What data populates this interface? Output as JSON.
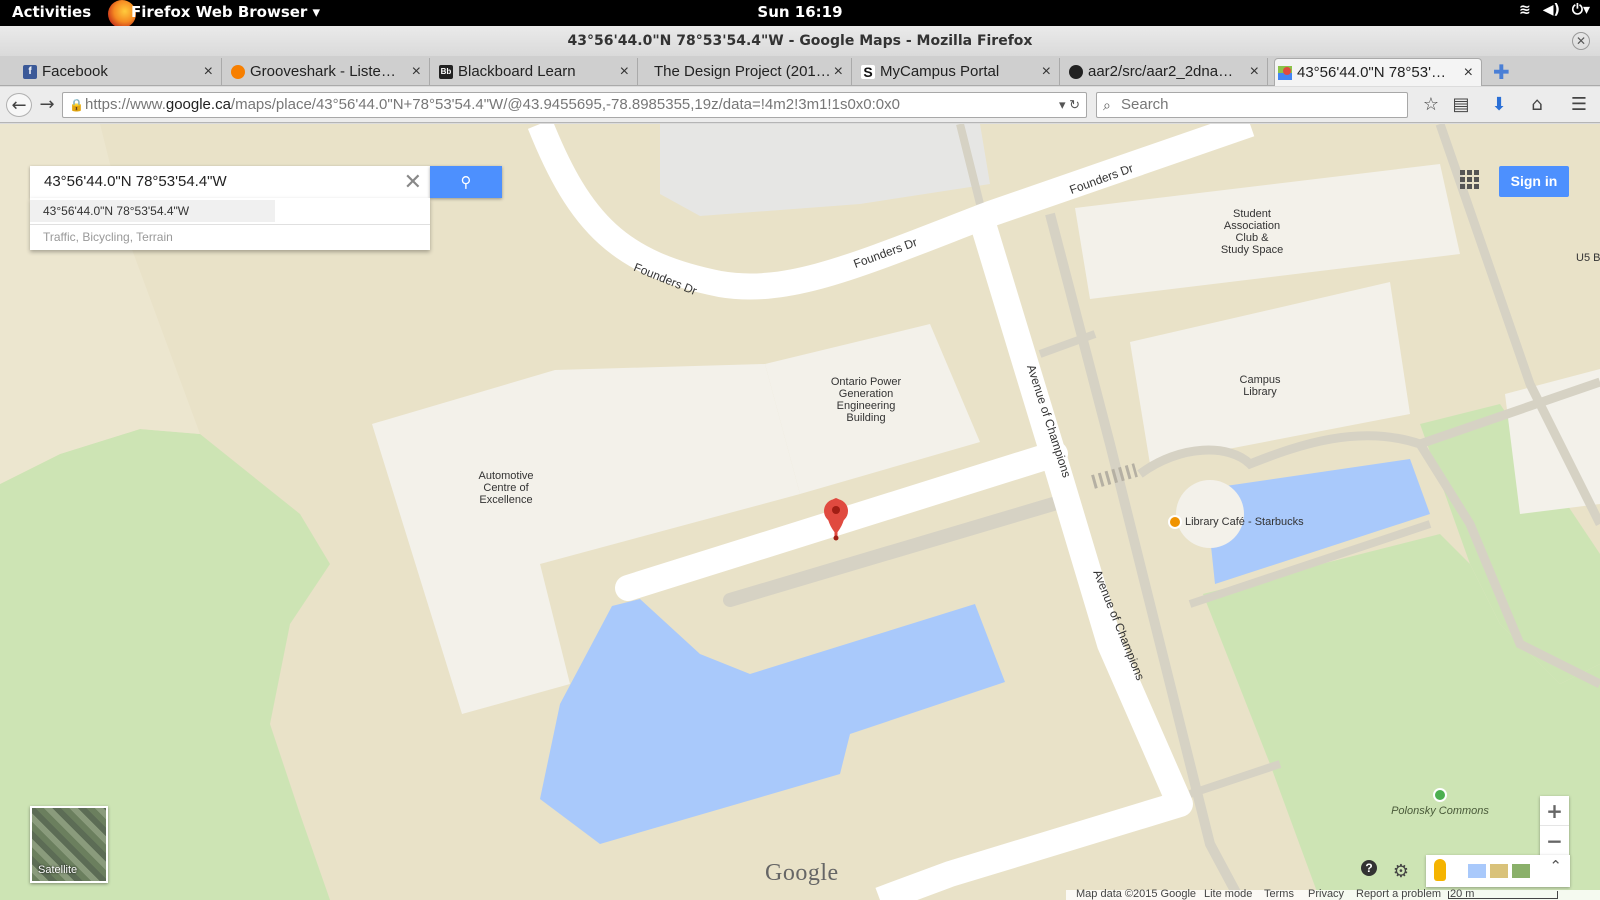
{
  "topbar": {
    "activities": "Activities",
    "app_menu": "Firefox Web Browser ▾",
    "clock": "Sun 16:19"
  },
  "window": {
    "title": "43°56'44.0\"N 78°53'54.4\"W - Google Maps - Mozilla Firefox"
  },
  "tabs": [
    {
      "label": "Facebook",
      "icon": "facebook-icon",
      "color": "#3b5998"
    },
    {
      "label": "Grooveshark - Liste…",
      "icon": "grooveshark-icon",
      "color": "#f77f00"
    },
    {
      "label": "Blackboard Learn",
      "icon": "blackboard-icon",
      "color": "#222222"
    },
    {
      "label": "The Design Project (201…",
      "icon": "",
      "color": ""
    },
    {
      "label": "MyCampus Portal",
      "icon": "s-icon",
      "color": "#111111"
    },
    {
      "label": "aar2/src/aar2_2dna…",
      "icon": "github-icon",
      "color": "#222222"
    },
    {
      "label": "43°56'44.0\"N 78°53'…",
      "icon": "google-maps-icon",
      "color": "#e04a3f"
    }
  ],
  "navbar": {
    "url_prefix": "https://www.",
    "url_host": "google.ca",
    "url_rest": "/maps/place/43°56'44.0\"N+78°53'54.4\"W/@43.9455695,-78.8985355,19z/data=!4m2!3m1!1s0x0:0x0",
    "search_placeholder": "Search"
  },
  "map": {
    "search_value": "43°56'44.0\"N 78°53'54.4\"W",
    "suggestion_1": "43°56'44.0\"N 78°53'54.4\"W",
    "suggestion_2": "Traffic, Bicycling, Terrain",
    "sign_in": "Sign in",
    "satellite": "Satellite",
    "google": "Google",
    "labels": {
      "student_association": "Student\nAssociation\nClub &\nStudy Space",
      "us": "U5 B",
      "campus_library": "Campus\nLibrary",
      "opg": "Ontario Power\nGeneration\nEngineering\nBuilding",
      "automotive": "Automotive\nCentre of\nExcellence",
      "library_cafe": "Library Café - Starbucks",
      "polonsky": "Polonsky Commons"
    },
    "roads": {
      "founders_1": "Founders Dr",
      "founders_2": "Founders Dr",
      "founders_3": "Founders Dr",
      "avenue_1": "Avenue of Champions",
      "avenue_2": "Avenue of Champions"
    },
    "footer": {
      "map_data": "Map data ©2015 Google",
      "lite_mode": "Lite mode",
      "terms": "Terms",
      "privacy": "Privacy",
      "report": "Report a problem",
      "scale": "20 m"
    },
    "colors": {
      "land": "#e9e2c8",
      "building": "#f3f1ea",
      "water": "#a9c9fb",
      "park": "#cde4b4",
      "road": "#ffffff",
      "path": "#d6d2c4",
      "accent": "#4d90fe"
    }
  }
}
